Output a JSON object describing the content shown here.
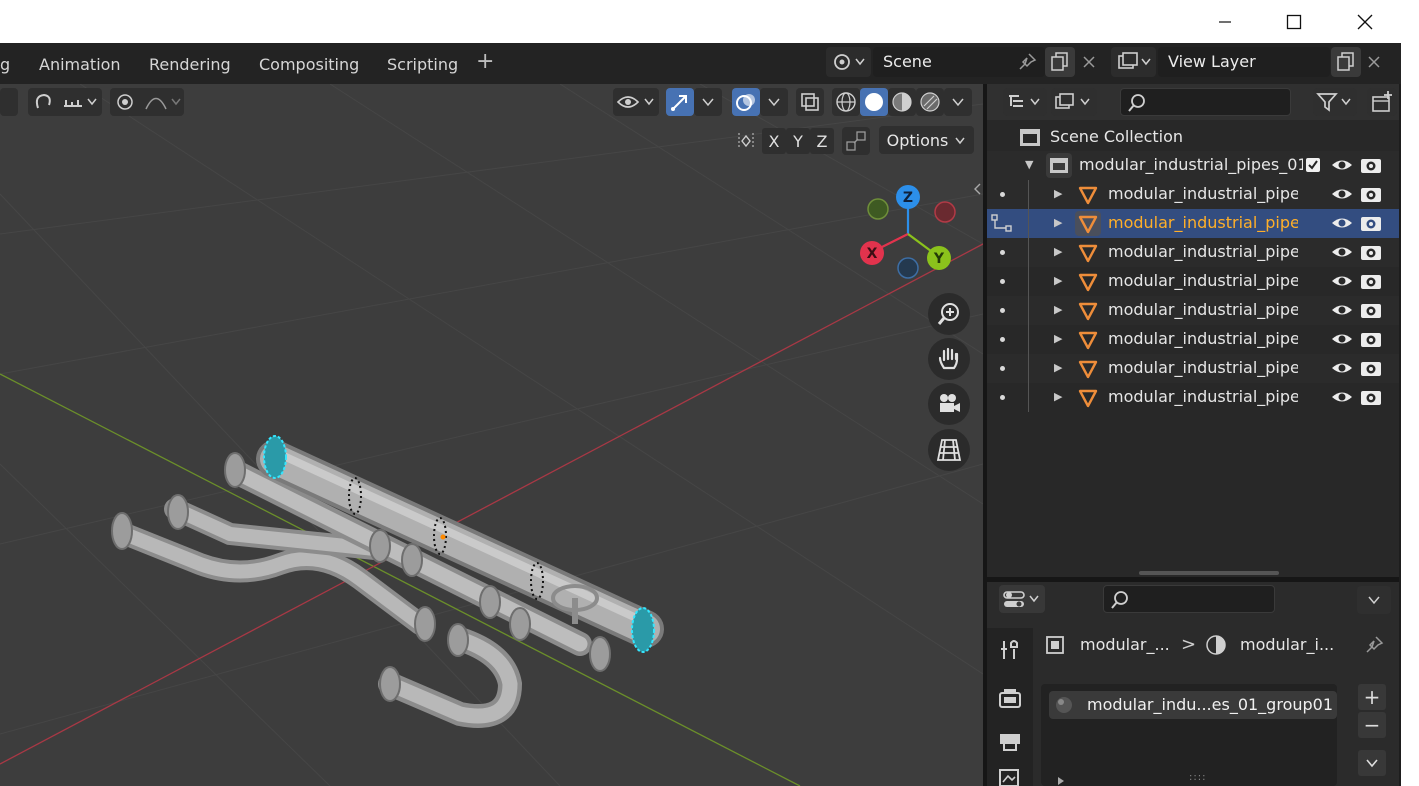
{
  "window": {
    "minimize": "—",
    "maximize": "□",
    "close": "✕"
  },
  "workspace_tabs": [
    "g",
    "Animation",
    "Rendering",
    "Compositing",
    "Scripting"
  ],
  "workspace_add": "+",
  "scene": {
    "name": "Scene",
    "view_layer": "View Layer"
  },
  "viewport": {
    "mirror_axes": [
      "X",
      "Y",
      "Z"
    ],
    "options_label": "Options",
    "gizmo": {
      "z": "Z",
      "x": "X",
      "y": "Y"
    }
  },
  "outliner": {
    "collection_label": "Scene Collection",
    "child_collection": "modular_industrial_pipes_01",
    "objects": [
      {
        "label": "modular_industrial_pipes",
        "selected": false
      },
      {
        "label": "modular_industrial_pipes",
        "selected": true
      },
      {
        "label": "modular_industrial_pipes",
        "selected": false
      },
      {
        "label": "modular_industrial_pipes",
        "selected": false
      },
      {
        "label": "modular_industrial_pipes",
        "selected": false
      },
      {
        "label": "modular_industrial_pipes",
        "selected": false
      },
      {
        "label": "modular_industrial_pipes",
        "selected": false
      },
      {
        "label": "modular_industrial_pipes",
        "selected": false
      }
    ]
  },
  "properties": {
    "breadcrumb_object": "modular_...",
    "breadcrumb_sep": ">",
    "breadcrumb_material": "modular_i...",
    "material_slot": "modular_indu...es_01_group01",
    "add": "+",
    "remove": "−",
    "more": "::::"
  },
  "colors": {
    "accent": "#4772b3",
    "active_text": "#ffaf29",
    "axis_x": "#e2334d",
    "axis_y": "#8bc21c",
    "axis_z": "#2c8fea"
  }
}
